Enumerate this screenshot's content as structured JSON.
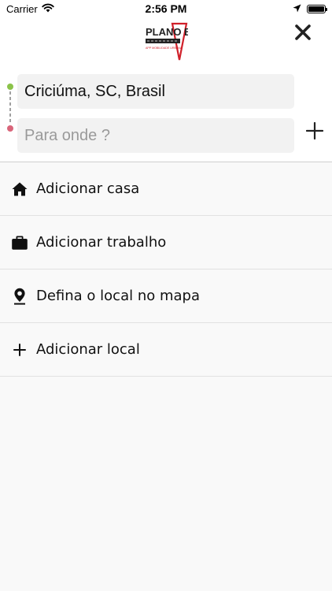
{
  "status_bar": {
    "carrier": "Carrier",
    "time": "2:56 PM"
  },
  "header": {
    "logo_text": "PLANO B",
    "logo_tagline": "APP MOBILIDADE URBANA",
    "logo_color": "#d0202a"
  },
  "route": {
    "origin_value": "Criciúma, SC, Brasil",
    "destination_placeholder": "Para onde ?",
    "origin_dot_color": "#8bc34a",
    "destination_dot_color": "#d9657a"
  },
  "list": {
    "items": [
      {
        "label": "Adicionar casa",
        "icon": "home-icon"
      },
      {
        "label": "Adicionar trabalho",
        "icon": "briefcase-icon"
      },
      {
        "label": "Defina o local no mapa",
        "icon": "map-pin-icon"
      },
      {
        "label": "Adicionar local",
        "icon": "plus-icon"
      }
    ]
  }
}
